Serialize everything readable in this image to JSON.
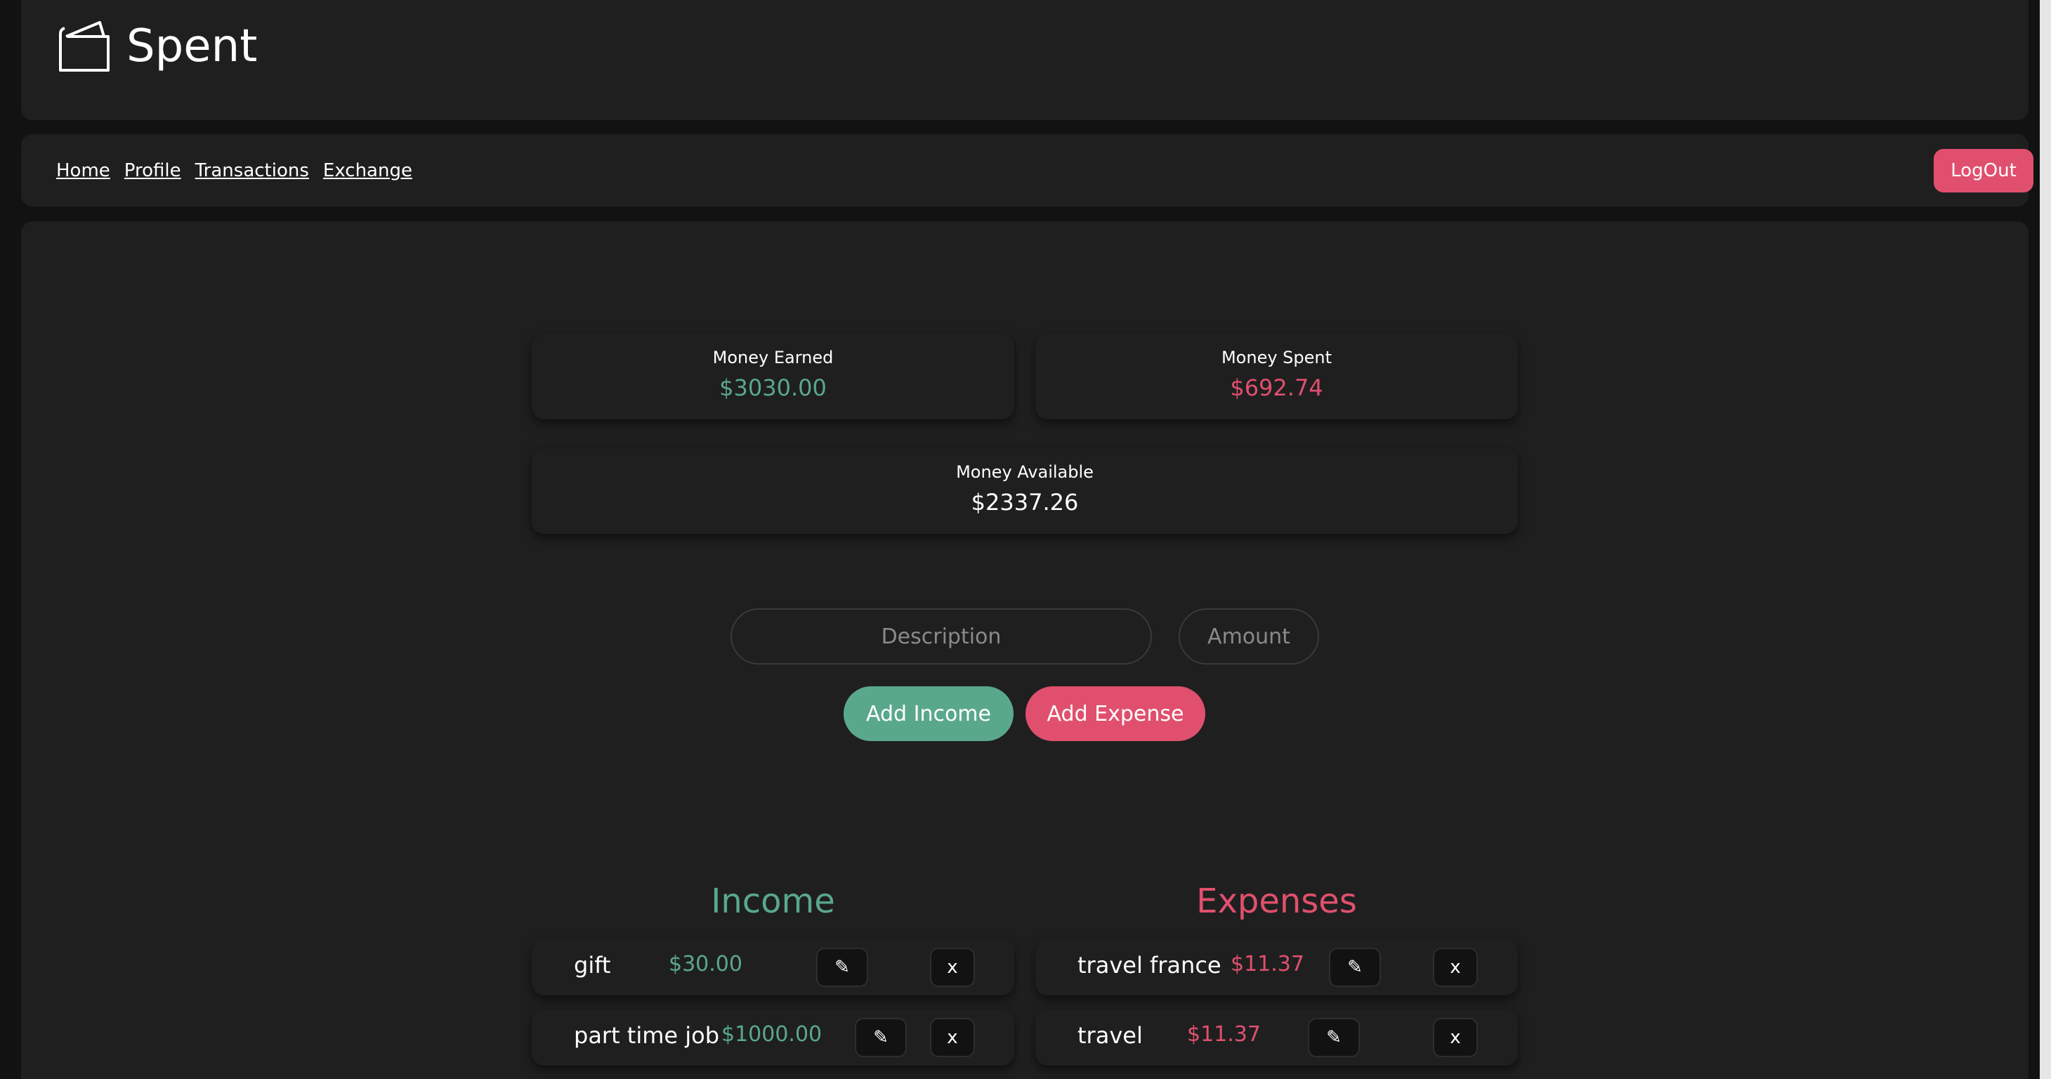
{
  "app": {
    "title": "Spent",
    "logo_icon": "wallet-icon"
  },
  "nav": {
    "links": [
      "Home",
      "Profile",
      "Transactions",
      "Exchange"
    ],
    "logout_label": "LogOut"
  },
  "summary": {
    "earned": {
      "label": "Money Earned",
      "value": "$3030.00"
    },
    "spent": {
      "label": "Money Spent",
      "value": "$692.74"
    },
    "available": {
      "label": "Money Available",
      "value": "$2337.26"
    }
  },
  "form": {
    "description_placeholder": "Description",
    "amount_placeholder": "Amount",
    "add_income_label": "Add Income",
    "add_expense_label": "Add Expense"
  },
  "income": {
    "title": "Income",
    "items": [
      {
        "description": "gift",
        "amount": "$30.00",
        "edit": "✎",
        "delete": "x"
      },
      {
        "description": "part time job",
        "amount": "$1000.00",
        "edit": "✎",
        "delete": "x"
      }
    ]
  },
  "expenses": {
    "title": "Expenses",
    "items": [
      {
        "description": "travel france",
        "amount": "$11.37",
        "edit": "✎",
        "delete": "x"
      },
      {
        "description": "travel",
        "amount": "$11.37",
        "edit": "✎",
        "delete": "x"
      }
    ]
  },
  "colors": {
    "income": "#5aa88c",
    "expense": "#e0506e",
    "background": "#121212",
    "panel": "#1f1f1f"
  }
}
